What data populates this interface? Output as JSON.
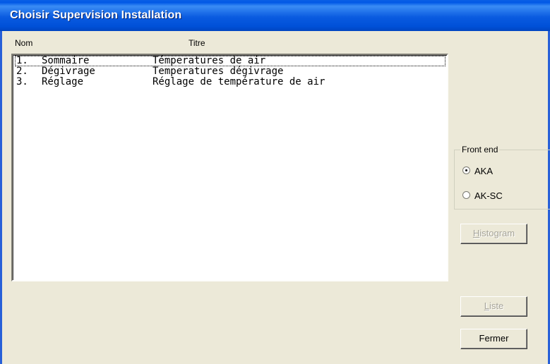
{
  "window": {
    "title": "Choisir Supervision Installation"
  },
  "list": {
    "headers": {
      "nom": "Nom",
      "titre": "Titre"
    },
    "rows": [
      {
        "num": "1.",
        "nom": "Sommaire",
        "titre": "Témperatures de air"
      },
      {
        "num": "2.",
        "nom": "Dégivrage",
        "titre": "Temperatures dégivrage"
      },
      {
        "num": "3.",
        "nom": "Réglage",
        "titre": "Réglage de température de air"
      }
    ],
    "focused_row": 1
  },
  "front_end": {
    "legend": "Front end",
    "options": [
      {
        "label": "AKA",
        "checked": true
      },
      {
        "label": "AK-SC",
        "checked": false
      }
    ]
  },
  "buttons": {
    "histogram": {
      "accel": "H",
      "rest": "istogram",
      "enabled": false
    },
    "liste": {
      "accel": "L",
      "rest": "iste",
      "enabled": false
    },
    "fermer": {
      "label": "Fermer",
      "enabled": true
    }
  }
}
